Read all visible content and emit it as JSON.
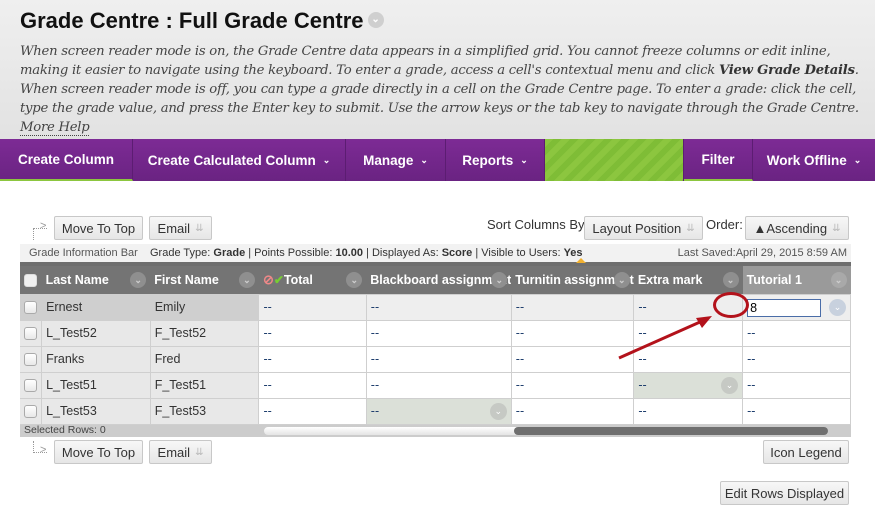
{
  "header": {
    "title": "Grade Centre : Full Grade Centre",
    "instructions_part1": "When screen reader mode is on, the Grade Centre data appears in a simplified grid. You cannot freeze columns or edit inline, making it easier to navigate using the keyboard. To enter a grade, access a cell's contextual menu and click ",
    "instructions_bold": "View Grade Details",
    "instructions_part2": ". When screen reader mode is off, you can type a grade directly in a cell on the Grade Centre page. To enter a grade: click the cell, type the grade value, and press the Enter key to submit. Use the arrow keys or the tab key to navigate through the Grade Centre. ",
    "more_help": "More Help"
  },
  "nav": {
    "items": [
      {
        "label": "Create Column",
        "dropdown": false
      },
      {
        "label": "Create Calculated Column",
        "dropdown": true
      },
      {
        "label": "Manage",
        "dropdown": true
      },
      {
        "label": "Reports",
        "dropdown": true
      },
      {
        "label": "Filter",
        "dropdown": false
      },
      {
        "label": "Work Offline",
        "dropdown": true
      }
    ],
    "colors": {
      "bar": "#7a2a92",
      "green": "#8cc63f"
    }
  },
  "toolbar": {
    "move_to_top": "Move To Top",
    "email": "Email",
    "sort_columns_label": "Sort Columns By:",
    "sort_columns_value": "Layout Position",
    "order_label": "Order:",
    "order_value": "▲Ascending"
  },
  "info_bar": {
    "label": "Grade Information Bar",
    "grade_type_label": "Grade Type: ",
    "grade_type": "Grade",
    "points_label": " | Points Possible: ",
    "points": "10.00",
    "displayed_label": " | Displayed As: ",
    "displayed": "Score",
    "visible_label": " | Visible to Users: ",
    "visible": "Yes",
    "last_saved": "Last Saved:April 29, 2015 8:59 AM"
  },
  "grid": {
    "columns": [
      "Last Name",
      "First Name",
      "Total",
      "Blackboard assignment",
      "Turnitin assignment",
      "Extra mark",
      "Tutorial 1"
    ],
    "rows": [
      {
        "last": "Ernest",
        "first": "Emily",
        "grades": [
          "--",
          "--",
          "--",
          "--",
          "8"
        ]
      },
      {
        "last": "L_Test52",
        "first": "F_Test52",
        "grades": [
          "--",
          "--",
          "--",
          "--",
          "--"
        ]
      },
      {
        "last": "Franks",
        "first": "Fred",
        "grades": [
          "--",
          "--",
          "--",
          "--",
          "--"
        ]
      },
      {
        "last": "L_Test51",
        "first": "F_Test51",
        "grades": [
          "--",
          "--",
          "--",
          "--",
          "--"
        ]
      },
      {
        "last": "L_Test53",
        "first": "F_Test53",
        "grades": [
          "--",
          "--",
          "--",
          "--",
          "--"
        ]
      }
    ],
    "selected_rows": "Selected Rows: 0"
  },
  "bottom": {
    "icon_legend": "Icon Legend",
    "edit_rows": "Edit Rows Displayed"
  },
  "annotation": {
    "color": "#b3121b"
  }
}
